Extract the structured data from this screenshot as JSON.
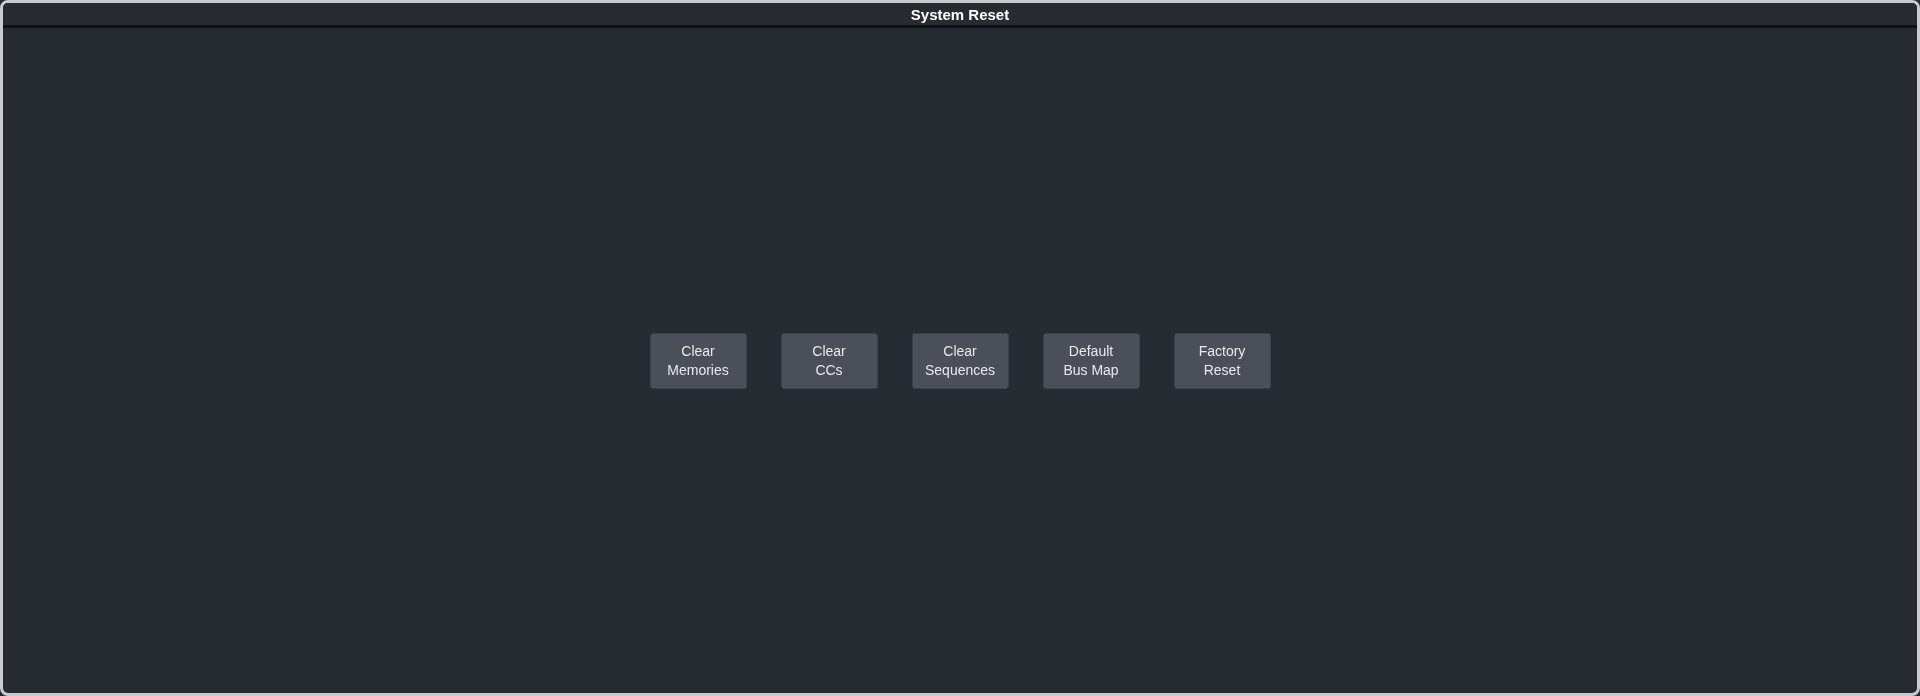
{
  "window": {
    "title": "System Reset"
  },
  "buttons": [
    {
      "lines": [
        "Clear",
        "Memories"
      ]
    },
    {
      "lines": [
        "Clear",
        "CCs"
      ]
    },
    {
      "lines": [
        "Clear",
        "Sequences"
      ]
    },
    {
      "lines": [
        "Default",
        "Bus Map"
      ]
    },
    {
      "lines": [
        "Factory",
        "Reset"
      ]
    }
  ]
}
